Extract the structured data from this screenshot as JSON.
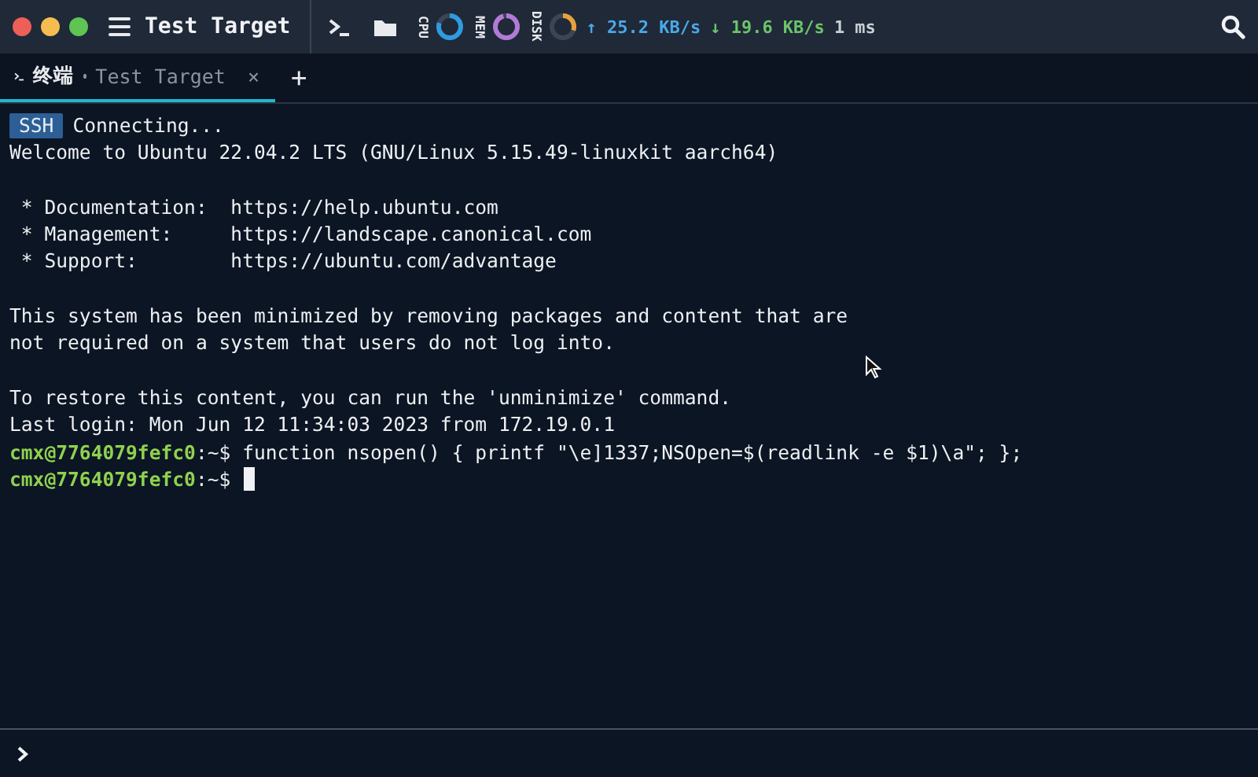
{
  "window": {
    "title": "Test Target"
  },
  "meters": [
    {
      "label": "CPU",
      "level": 0.8,
      "color": "#2f9be0"
    },
    {
      "label": "MEM",
      "level": 0.95,
      "color": "#b27ad6"
    },
    {
      "label": "DISK",
      "level": 0.3,
      "color": "#e8a13a"
    }
  ],
  "network": {
    "upload": "↑ 25.2 KB/s",
    "download": "↓ 19.6 KB/s",
    "latency": "1 ms"
  },
  "tabs": [
    {
      "title": "终端",
      "subtitle": "Test Target",
      "close": "×",
      "selected": true
    }
  ],
  "new_tab": "+",
  "terminal": {
    "lines": [
      {
        "kind": "badge",
        "badge": "SSH",
        "text": "Connecting..."
      },
      {
        "kind": "text",
        "text": "Welcome to Ubuntu 22.04.2 LTS (GNU/Linux 5.15.49-linuxkit aarch64)"
      },
      {
        "kind": "blank"
      },
      {
        "kind": "text",
        "text": " * Documentation:  https://help.ubuntu.com"
      },
      {
        "kind": "text",
        "text": " * Management:     https://landscape.canonical.com"
      },
      {
        "kind": "text",
        "text": " * Support:        https://ubuntu.com/advantage"
      },
      {
        "kind": "blank"
      },
      {
        "kind": "text",
        "text": "This system has been minimized by removing packages and content that are"
      },
      {
        "kind": "text",
        "text": "not required on a system that users do not log into."
      },
      {
        "kind": "blank"
      },
      {
        "kind": "text",
        "text": "To restore this content, you can run the 'unminimize' command."
      },
      {
        "kind": "text",
        "text": "Last login: Mon Jun 12 11:34:03 2023 from 172.19.0.1"
      },
      {
        "kind": "prompt",
        "user": "cmx@7764079fefc0",
        "path": ":~$",
        "command": "function nsopen() { printf \"\\e]1337;NSOpen=$(readlink -e $1)\\a\"; };"
      },
      {
        "kind": "prompt",
        "user": "cmx@7764079fefc0",
        "path": ":~$",
        "cursor": true
      }
    ]
  }
}
